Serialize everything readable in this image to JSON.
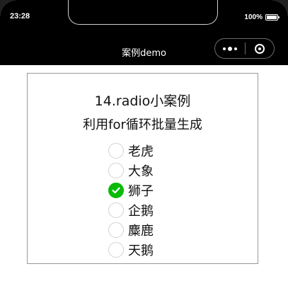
{
  "status_bar": {
    "time": "23:28",
    "battery": "100%"
  },
  "nav": {
    "title": "案例demo"
  },
  "page": {
    "title": "14.radio小案例",
    "subtitle": "利用for循环批量生成"
  },
  "radios": [
    {
      "label": "老虎",
      "checked": false
    },
    {
      "label": "大象",
      "checked": false
    },
    {
      "label": "狮子",
      "checked": true
    },
    {
      "label": "企鹅",
      "checked": false
    },
    {
      "label": "麋鹿",
      "checked": false
    },
    {
      "label": "天鹅",
      "checked": false
    }
  ],
  "colors": {
    "checked": "#09bb07",
    "nav_background": "#000000"
  }
}
